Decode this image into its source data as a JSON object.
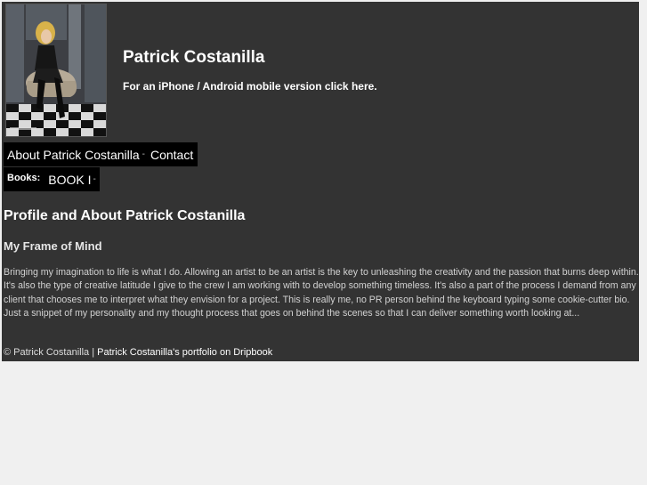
{
  "header": {
    "photo_alt": "Patrick Costanilla",
    "title": "Patrick Costanilla",
    "mobile_prefix": "For an iPhone / Android mobile version click ",
    "mobile_link": "here",
    "mobile_suffix": "."
  },
  "nav": {
    "items": [
      {
        "label": "About Patrick Costanilla"
      },
      {
        "label": "Contact"
      }
    ],
    "separator": "-"
  },
  "books": {
    "label": "Books:",
    "items": [
      {
        "label": "BOOK I"
      }
    ],
    "separator": "-"
  },
  "content": {
    "heading": "Profile and About Patrick Costanilla",
    "subheading": "My Frame of Mind",
    "bio": "Bringing my imagination to life is what I do. Allowing an artist to be an artist is the key to unleashing the creativity and the passion that burns deep within. It's also the type of creative latitude I give to the crew I am working with to develop something timeless. It's also a part of the process I demand from any client that chooses me to interpret what they envision for a project. This is really me, no PR person behind the keyboard typing some cookie-cutter bio. Just a snippet of my personality and my thought process that goes on behind the scenes so that I can deliver something worth looking at..."
  },
  "footer": {
    "copyright": "© Patrick Costanilla",
    "divider": " | ",
    "portfolio_link": "Patrick Costanilla's portfolio on Dripbook"
  },
  "colors": {
    "page_background": "#333333",
    "nav_background": "#000000",
    "outer_background": "#f0f0f0"
  }
}
